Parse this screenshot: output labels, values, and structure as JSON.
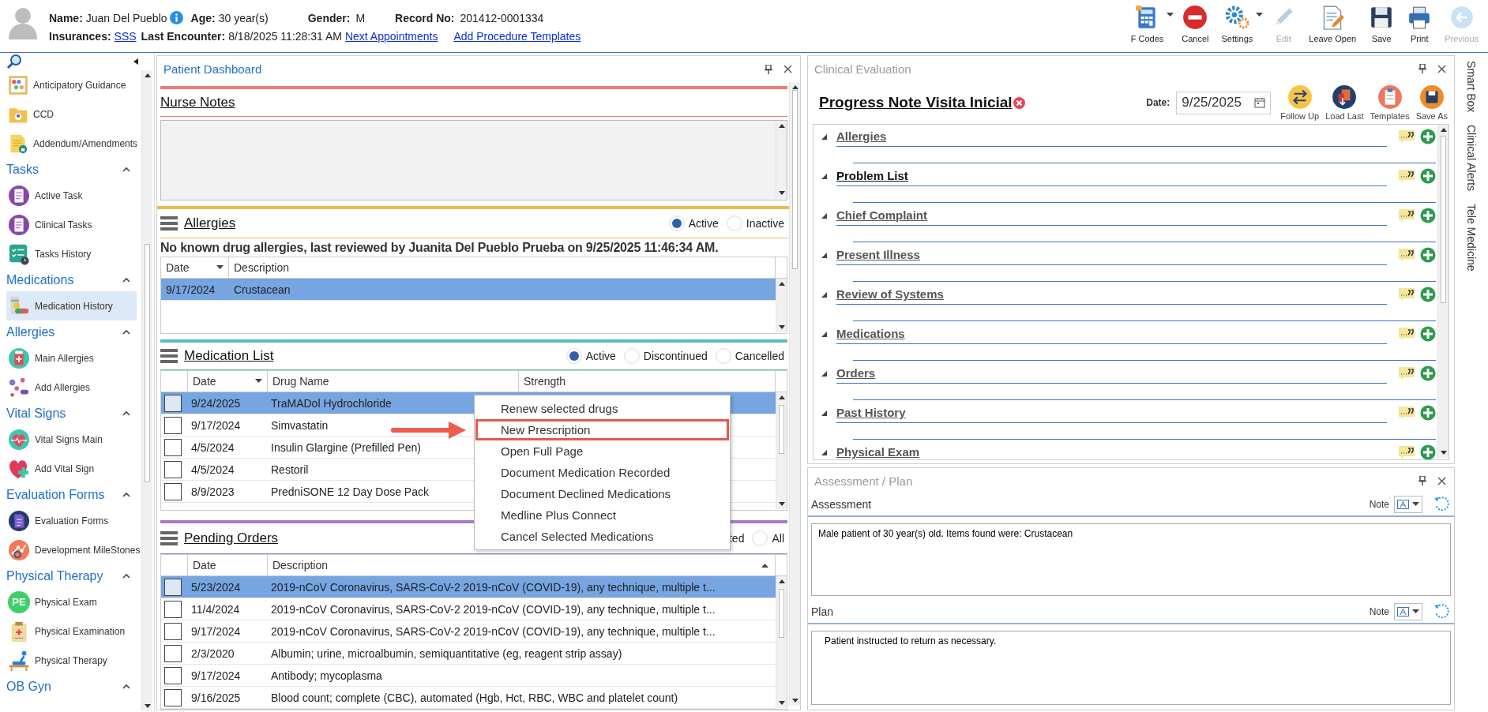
{
  "header": {
    "patient": {
      "name_label": "Name:",
      "name": "Juan Del Pueblo",
      "age_label": "Age:",
      "age": "30 year(s)",
      "gender_label": "Gender:",
      "gender": "M",
      "record_label": "Record No:",
      "record": "201412-0001334",
      "insurances_label": "Insurances:",
      "insurance": "SSS",
      "last_encounter_label": "Last Encounter:",
      "last_encounter": "8/18/2025 11:28:31 AM"
    },
    "links": [
      "Next Appointments",
      "Add Procedure Templates"
    ],
    "toolbar": [
      {
        "label": "F Codes",
        "dropdown": true,
        "disabled": false
      },
      {
        "label": "Cancel",
        "dropdown": false,
        "disabled": false
      },
      {
        "label": "Settings",
        "dropdown": true,
        "disabled": false
      },
      {
        "label": "Edit",
        "dropdown": false,
        "disabled": true
      },
      {
        "label": "Leave Open",
        "dropdown": false,
        "disabled": false
      },
      {
        "label": "Save",
        "dropdown": false,
        "disabled": false
      },
      {
        "label": "Print",
        "dropdown": false,
        "disabled": false
      },
      {
        "label": "Previous",
        "dropdown": false,
        "disabled": true
      }
    ]
  },
  "sidebar": {
    "groups": [
      {
        "items": [
          {
            "label": "Anticipatory Guidance",
            "selected": false
          },
          {
            "label": "CCD",
            "selected": false
          },
          {
            "label": "Addendum/Amendments",
            "selected": false
          }
        ]
      },
      {
        "title": "Tasks",
        "expanded": true,
        "items": [
          {
            "label": "Active Task",
            "selected": false
          },
          {
            "label": "Clinical Tasks",
            "selected": false
          },
          {
            "label": "Tasks History",
            "selected": false
          }
        ]
      },
      {
        "title": "Medications",
        "expanded": true,
        "items": [
          {
            "label": "Medication History",
            "selected": true
          }
        ]
      },
      {
        "title": "Allergies",
        "expanded": true,
        "items": [
          {
            "label": "Main Allergies",
            "selected": false
          },
          {
            "label": "Add Allergies",
            "selected": false
          }
        ]
      },
      {
        "title": "Vital Signs",
        "expanded": true,
        "items": [
          {
            "label": "Vital Signs Main",
            "selected": false
          },
          {
            "label": "Add Vital Sign",
            "selected": false
          }
        ]
      },
      {
        "title": "Evaluation Forms",
        "expanded": true,
        "items": [
          {
            "label": "Evaluation Forms",
            "selected": false
          },
          {
            "label": "Development MileStones",
            "selected": false
          }
        ]
      },
      {
        "title": "Physical Therapy",
        "expanded": true,
        "items": [
          {
            "label": "Physical Exam",
            "icon_text": "PE",
            "selected": false
          },
          {
            "label": "Physical Examination",
            "selected": false
          },
          {
            "label": "Physical Therapy",
            "selected": false
          }
        ]
      },
      {
        "title": "OB Gyn",
        "expanded": true
      }
    ]
  },
  "dashboard": {
    "title": "Patient Dashboard",
    "nurse_notes": {
      "title": "Nurse Notes"
    },
    "allergies": {
      "title": "Allergies",
      "filters": [
        {
          "label": "Active",
          "selected": true
        },
        {
          "label": "Inactive",
          "selected": false
        }
      ],
      "review": "No known drug allergies, last reviewed by Juanita Del Pueblo Prueba on 9/25/2025 11:46:34 AM.",
      "columns": [
        "Date",
        "Description"
      ],
      "rows": [
        {
          "date": "9/17/2024",
          "description": "Crustacean",
          "selected": true
        }
      ]
    },
    "medication_list": {
      "title": "Medication List",
      "filters": [
        {
          "label": "Active",
          "selected": true
        },
        {
          "label": "Discontinued",
          "selected": false
        },
        {
          "label": "Cancelled",
          "selected": false
        }
      ],
      "columns": [
        "Date",
        "Drug Name",
        "Strength"
      ],
      "rows": [
        {
          "date": "9/24/2025",
          "drug": "TraMADol Hydrochloride",
          "selected": true,
          "checked": false
        },
        {
          "date": "9/17/2024",
          "drug": "Simvastatin",
          "selected": false,
          "checked": false
        },
        {
          "date": "4/5/2024",
          "drug": "Insulin Glargine (Prefilled Pen)",
          "selected": false,
          "checked": false
        },
        {
          "date": "4/5/2024",
          "drug": "Restoril",
          "selected": false,
          "checked": false
        },
        {
          "date": "8/9/2023",
          "drug": "PredniSONE 12 Day Dose Pack",
          "selected": false,
          "checked": false
        }
      ]
    },
    "pending_orders": {
      "title": "Pending Orders",
      "filters": [
        {
          "label": "ted"
        },
        {
          "label": "All",
          "selected": false
        }
      ],
      "columns": [
        "Date",
        "Description"
      ],
      "rows": [
        {
          "date": "5/23/2024",
          "description": "2019-nCoV Coronavirus, SARS-CoV-2 2019-nCoV (COVID-19), any technique, multiple t...",
          "selected": true,
          "checked": false
        },
        {
          "date": "11/4/2024",
          "description": "2019-nCoV Coronavirus, SARS-CoV-2 2019-nCoV (COVID-19), any technique, multiple t...",
          "selected": false,
          "checked": false
        },
        {
          "date": "9/17/2024",
          "description": "2019-nCoV Coronavirus, SARS-CoV-2 2019-nCoV (COVID-19), any technique, multiple t...",
          "selected": false,
          "checked": false
        },
        {
          "date": "2/3/2020",
          "description": "Albumin; urine, microalbumin, semiquantitative (eg, reagent strip assay)",
          "selected": false,
          "checked": false
        },
        {
          "date": "9/17/2024",
          "description": "Antibody; mycoplasma",
          "selected": false,
          "checked": false
        },
        {
          "date": "9/16/2025",
          "description": "Blood count; complete (CBC), automated (Hgb, Hct, RBC, WBC and platelet count)",
          "selected": false,
          "checked": false
        }
      ]
    }
  },
  "context_menu": {
    "items": [
      {
        "label": "Renew selected drugs",
        "highlighted": false
      },
      {
        "label": "New Prescription",
        "highlighted": true
      },
      {
        "label": "Open Full Page",
        "highlighted": false
      },
      {
        "label": "Document Medication Recorded",
        "highlighted": false
      },
      {
        "label": "Document Declined Medications",
        "highlighted": false
      },
      {
        "label": "Medline Plus Connect",
        "highlighted": false
      },
      {
        "label": "Cancel Selected Medications",
        "highlighted": false
      }
    ]
  },
  "clinical_evaluation": {
    "title": "Clinical Evaluation",
    "note_title": "Progress Note Visita Inicial",
    "date_label": "Date:",
    "date": "9/25/2025",
    "actions": [
      {
        "label": "Follow Up"
      },
      {
        "label": "Load Last"
      },
      {
        "label": "Templates"
      },
      {
        "label": "Save As"
      }
    ],
    "sections": [
      {
        "title": "Allergies",
        "bold": false
      },
      {
        "title": "Problem List",
        "bold": true
      },
      {
        "title": "Chief Complaint",
        "bold": false
      },
      {
        "title": "Present Illness",
        "bold": false
      },
      {
        "title": "Review of Systems",
        "bold": false
      },
      {
        "title": "Medications",
        "bold": false
      },
      {
        "title": "Orders",
        "bold": false
      },
      {
        "title": "Past History",
        "bold": false
      },
      {
        "title": "Physical Exam",
        "bold": false
      }
    ]
  },
  "assessment_plan": {
    "title": "Assessment / Plan",
    "fields": [
      {
        "label": "Assessment",
        "note_label": "Note",
        "text": "Male patient of 30 year(s) old. Items found were:  Crustacean"
      },
      {
        "label": "Plan",
        "note_label": "Note",
        "text": "Patient instructed to return as necessary."
      }
    ]
  },
  "side_tabs": [
    "Smart Box",
    "Clinical Alerts",
    "Tele Medicine"
  ]
}
